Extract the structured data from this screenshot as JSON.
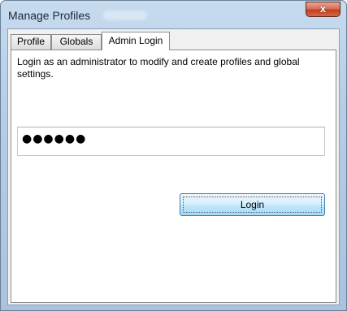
{
  "window": {
    "title": "Manage Profiles",
    "close_label": "x"
  },
  "tabs": [
    {
      "label": "Profile"
    },
    {
      "label": "Globals"
    },
    {
      "label": "Admin Login"
    }
  ],
  "admin_login": {
    "instructions": "Login as an administrator to modify and create profiles and global settings.",
    "password_value": "●●●●●●",
    "login_label": "Login"
  },
  "icons": {
    "close": "close-icon"
  }
}
